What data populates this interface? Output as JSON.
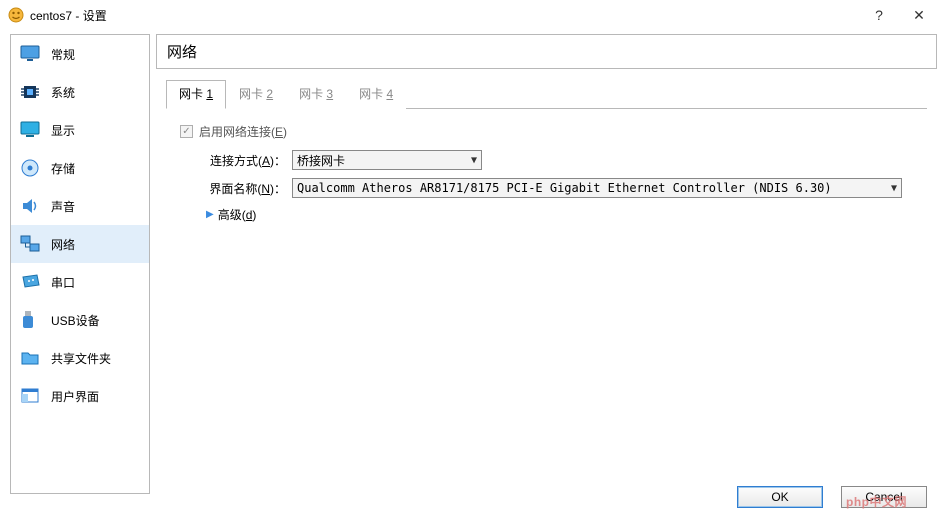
{
  "title": "centos7 - 设置",
  "titlebar": {
    "help": "?",
    "close": "✕"
  },
  "sidebar": {
    "items": [
      {
        "label": "常规"
      },
      {
        "label": "系统"
      },
      {
        "label": "显示"
      },
      {
        "label": "存储"
      },
      {
        "label": "声音"
      },
      {
        "label": "网络"
      },
      {
        "label": "串口"
      },
      {
        "label": "USB设备"
      },
      {
        "label": "共享文件夹"
      },
      {
        "label": "用户界面"
      }
    ]
  },
  "panel": {
    "title": "网络"
  },
  "tabs": [
    {
      "prefix": "网卡 ",
      "num": "1"
    },
    {
      "prefix": "网卡 ",
      "num": "2"
    },
    {
      "prefix": "网卡 ",
      "num": "3"
    },
    {
      "prefix": "网卡 ",
      "num": "4"
    }
  ],
  "form": {
    "enable_prefix": "启用网络连接(",
    "enable_u": "E",
    "enable_suffix": ")",
    "attach_prefix": "连接方式(",
    "attach_u": "A",
    "attach_suffix": ")：",
    "attach_value": "桥接网卡",
    "name_prefix": "界面名称(",
    "name_u": "N",
    "name_suffix": ")：",
    "name_value": "Qualcomm Atheros AR8171/8175 PCI-E Gigabit Ethernet Controller (NDIS 6.30)",
    "adv_prefix": "高级(",
    "adv_u": "d",
    "adv_suffix": ")"
  },
  "buttons": {
    "ok": "OK",
    "cancel": "Cancel"
  },
  "watermark": "php中文网"
}
